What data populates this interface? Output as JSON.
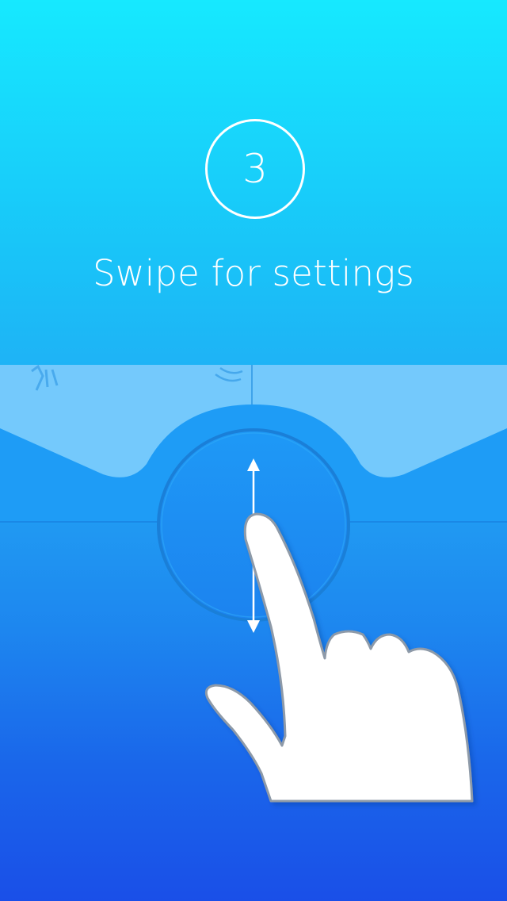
{
  "onboarding": {
    "step_number": "3",
    "title": "Swipe for settings"
  },
  "icons": {
    "gesture": "vertical-swipe-arrow-icon",
    "hand": "pointing-hand-icon",
    "sound": "sound-waves-icon"
  },
  "colors": {
    "top": "#16e9ff",
    "bottom": "#1a4fe8",
    "accent": "#ffffff"
  }
}
